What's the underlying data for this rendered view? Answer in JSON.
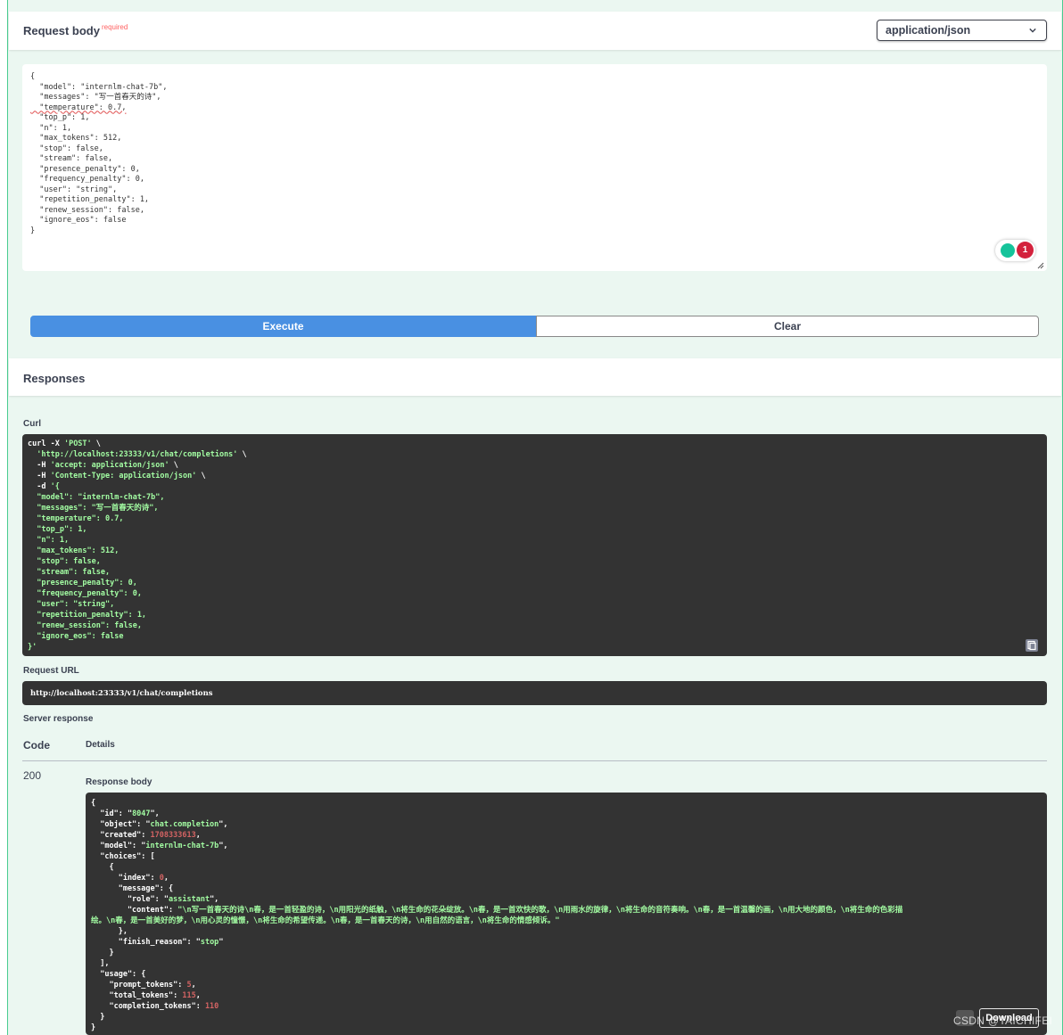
{
  "request_body": {
    "title": "Request body",
    "required_tag": "required",
    "content_type": "application/json",
    "editor_lines": [
      "{",
      "  \"model\": \"internlm-chat-7b\",",
      "  \"messages\": \"写一首春天的诗\",",
      "  \"temperature\": 0.7,",
      "  \"top_p\": 1,",
      "  \"n\": 1,",
      "  \"max_tokens\": 512,",
      "  \"stop\": false,",
      "  \"stream\": false,",
      "  \"presence_penalty\": 0,",
      "  \"frequency_penalty\": 0,",
      "  \"user\": \"string\",",
      "  \"repetition_penalty\": 1,",
      "  \"renew_session\": false,",
      "  \"ignore_eos\": false",
      "}"
    ],
    "grammar_issue_count": "1"
  },
  "actions": {
    "execute_label": "Execute",
    "clear_label": "Clear"
  },
  "responses": {
    "title": "Responses",
    "curl_label": "Curl",
    "curl_lines": [
      "curl -X 'POST' \\",
      "  'http://localhost:23333/v1/chat/completions' \\",
      "  -H 'accept: application/json' \\",
      "  -H 'Content-Type: application/json' \\",
      "  -d '{",
      "  \"model\": \"internlm-chat-7b\",",
      "  \"messages\": \"写一首春天的诗\",",
      "  \"temperature\": 0.7,",
      "  \"top_p\": 1,",
      "  \"n\": 1,",
      "  \"max_tokens\": 512,",
      "  \"stop\": false,",
      "  \"stream\": false,",
      "  \"presence_penalty\": 0,",
      "  \"frequency_penalty\": 0,",
      "  \"user\": \"string\",",
      "  \"repetition_penalty\": 1,",
      "  \"renew_session\": false,",
      "  \"ignore_eos\": false",
      "}'"
    ],
    "request_url_label": "Request URL",
    "request_url": "http://localhost:23333/v1/chat/completions",
    "server_response_label": "Server response",
    "code_header": "Code",
    "details_header": "Details",
    "status_code": "200",
    "response_body_label": "Response body",
    "response": {
      "id": "8047",
      "object": "chat.completion",
      "created": "1708333613",
      "model": "internlm-chat-7b",
      "index": "0",
      "role": "assistant",
      "content_line1": "\"\\n写一首春天的诗\\n春，是一首轻盈的诗，\\n用阳光的纸触，\\n将生命的花朵绽放。\\n春，是一首欢快的歌，\\n用雨水的旋律，\\n将生命的音符奏响。\\n春，是一首温馨的画，\\n用大地的颜色，\\n将生命的色彩描",
      "content_line2": "绘。\\n春，是一首美好的梦，\\n用心灵的憧憬，\\n将生命的希望传递。\\n春，是一首春天的诗，\\n用自然的语言，\\n将生命的情感倾诉。\"",
      "finish_reason": "stop",
      "prompt_tokens": "5",
      "total_tokens": "115",
      "completion_tokens": "110"
    },
    "download_label": "Download"
  },
  "watermark": "CSDN @TAICHIFEI",
  "colors": {
    "panel_bg": "#ebf7f1",
    "panel_border": "#49cc90",
    "execute": "#4990e2",
    "code_bg": "#333333",
    "string": "#a2fca2",
    "number": "#d36363",
    "required": "#ff6060"
  }
}
